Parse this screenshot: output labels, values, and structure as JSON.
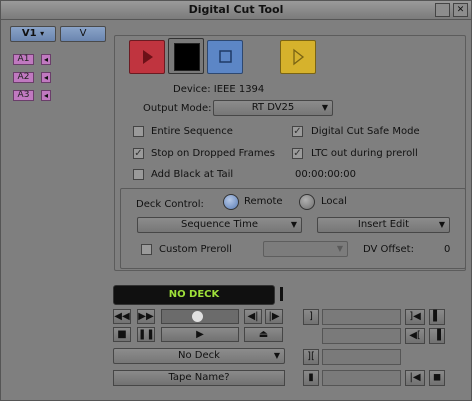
{
  "window": {
    "title": "Digital Cut Tool",
    "btn_left": "",
    "btn_right": "✕"
  },
  "tracks": {
    "video_label": "V1",
    "video_arrow": "▾",
    "video_target": "V",
    "audio": [
      "A1",
      "A2",
      "A3"
    ],
    "audio_arrow": "◂"
  },
  "device": {
    "label": "Device: IEEE 1394",
    "output_mode_label": "Output Mode:",
    "output_mode_value": "RT DV25"
  },
  "options": {
    "entire_sequence": "Entire Sequence",
    "stop_on_dropped": "Stop on Dropped Frames",
    "add_black": "Add Black at Tail",
    "safe_mode": "Digital Cut Safe Mode",
    "ltc_out": "LTC out during preroll",
    "timecode": "00:00:00:00",
    "check_mark": "✓"
  },
  "deck_control": {
    "label": "Deck Control:",
    "remote": "Remote",
    "local": "Local",
    "sequence_time": "Sequence Time",
    "insert_edit": "Insert Edit",
    "custom_preroll": "Custom Preroll",
    "dv_offset_label": "DV Offset:",
    "dv_offset_value": "0"
  },
  "transport": {
    "status": "NO DECK",
    "deck_select": "No Deck",
    "tape_name": "Tape Name?"
  },
  "colors": {
    "record": "#c0343f",
    "stop": "#5c86c6",
    "play": "#d6b22c",
    "status_text": "#9fe03a"
  },
  "icons": {
    "record": "record-icon",
    "black": "black-frame-icon",
    "stop": "stop-icon",
    "preview": "play-preview-icon"
  }
}
